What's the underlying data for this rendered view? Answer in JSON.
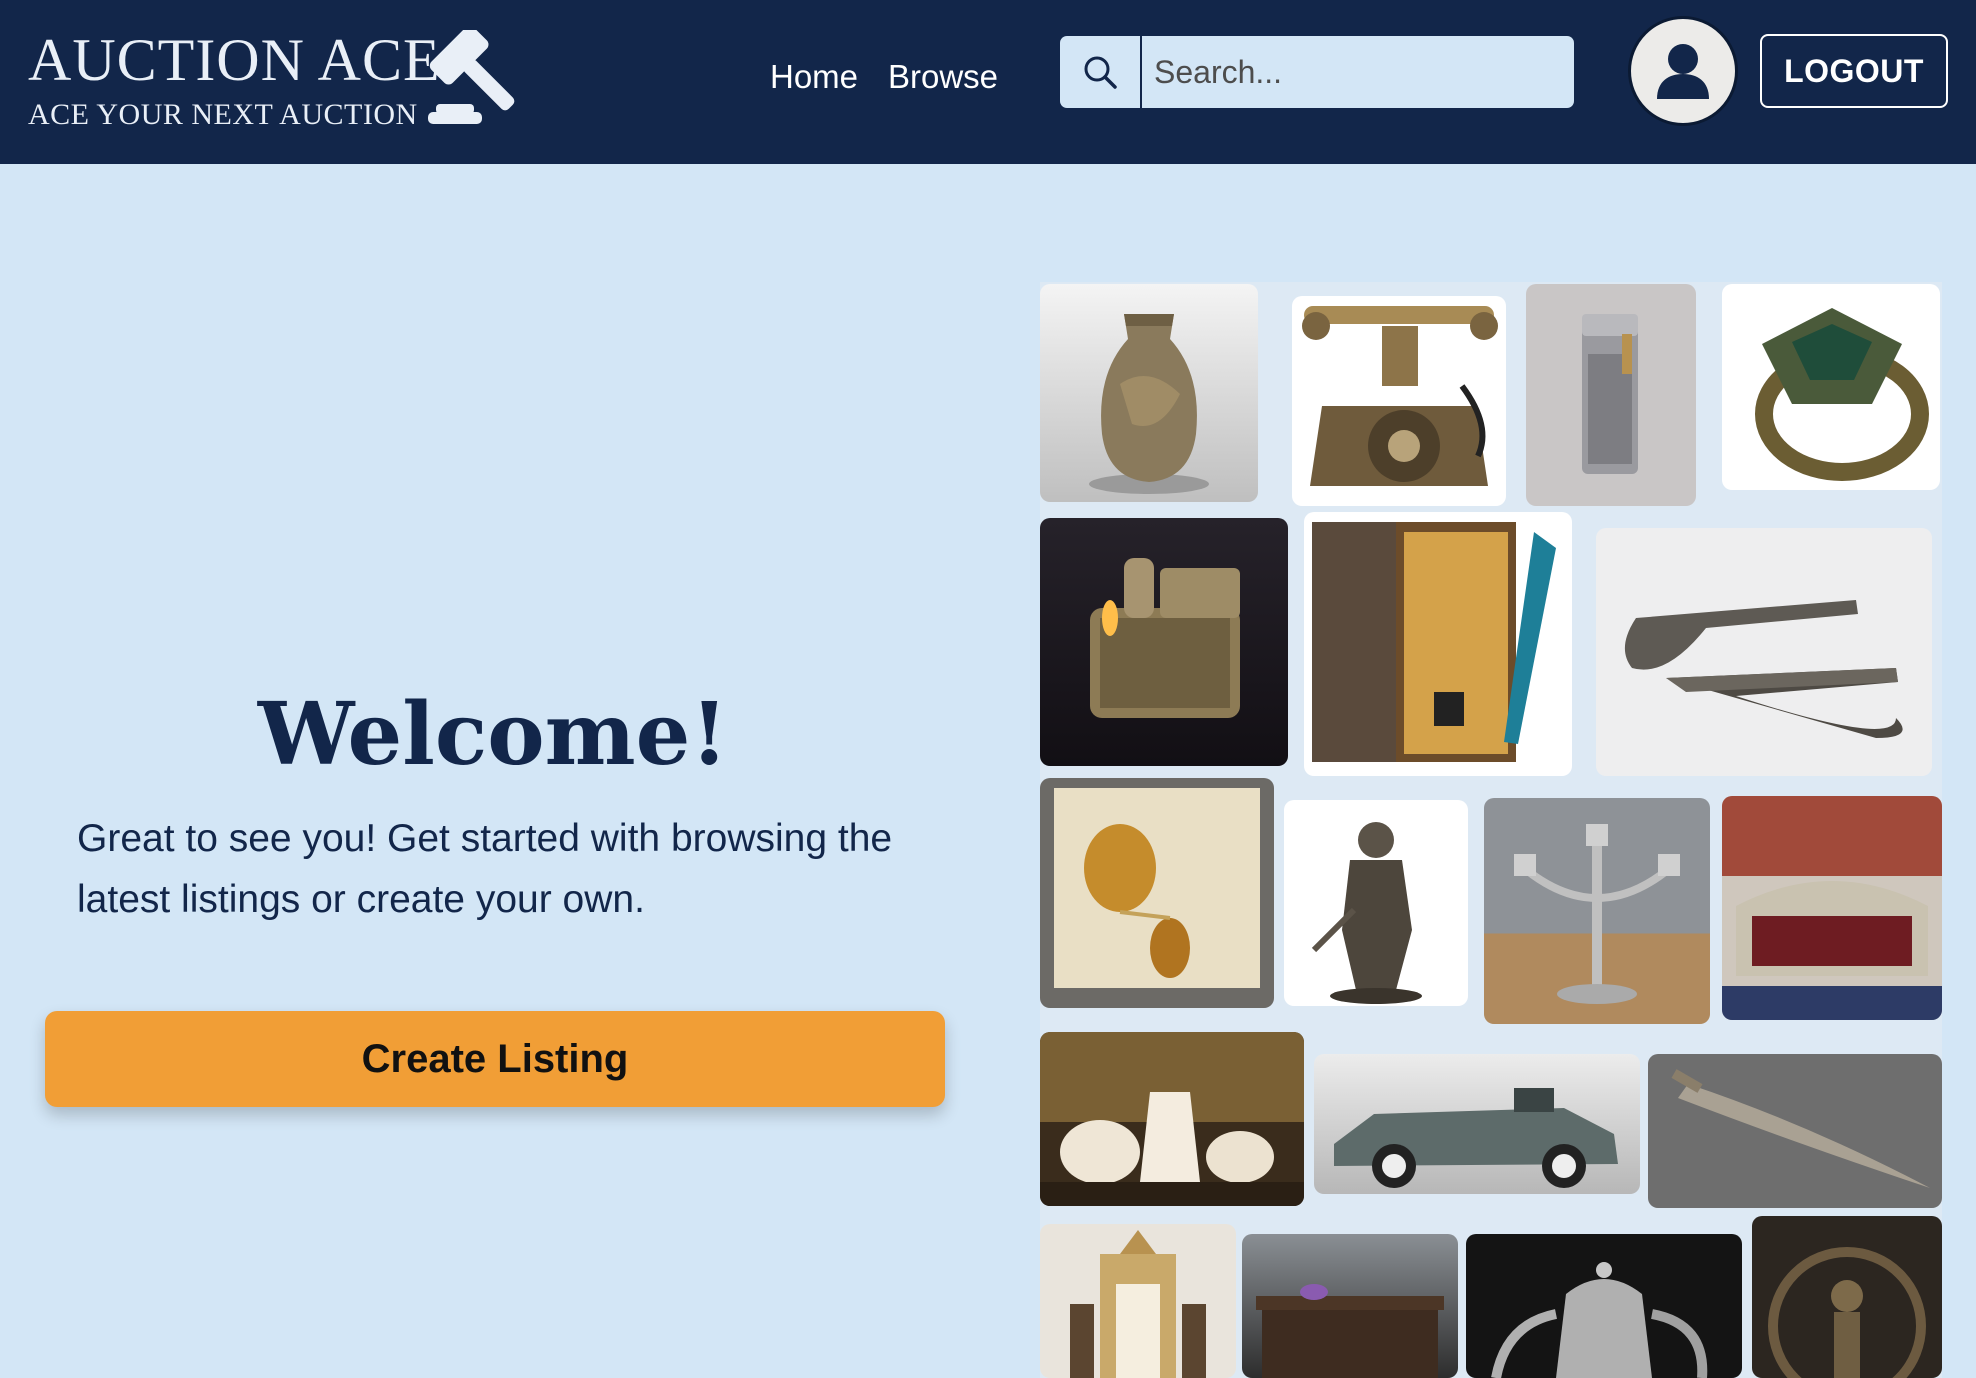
{
  "header": {
    "brand_title": "AUCTION ACE",
    "brand_tagline": "ACE YOUR NEXT AUCTION",
    "nav": [
      {
        "label": "Home"
      },
      {
        "label": "Browse"
      }
    ],
    "search": {
      "placeholder": "Search...",
      "value": ""
    },
    "logout_label": "LOGOUT"
  },
  "main": {
    "welcome_title": "Welcome!",
    "intro_text": "Great to see you! Get started with browsing the latest listings or create your own.",
    "create_listing_label": "Create Listing"
  },
  "gallery": {
    "items": [
      {
        "icon": "bronze-vase"
      },
      {
        "icon": "antique-telephone"
      },
      {
        "icon": "silver-lighter"
      },
      {
        "icon": "jade-ring"
      },
      {
        "icon": "engraved-lighter"
      },
      {
        "icon": "quill-pen-set"
      },
      {
        "icon": "flintlock-pistols"
      },
      {
        "icon": "amber-pendant"
      },
      {
        "icon": "warrior-statue"
      },
      {
        "icon": "candelabra"
      },
      {
        "icon": "baroque-sofa"
      },
      {
        "icon": "porcelain-tea-set"
      },
      {
        "icon": "vintage-car"
      },
      {
        "icon": "sabre"
      },
      {
        "icon": "ornate-clock"
      },
      {
        "icon": "carved-chest"
      },
      {
        "icon": "pewter-teapot"
      },
      {
        "icon": "bronze-deity-statue"
      }
    ]
  },
  "colors": {
    "header_bg": "#12264a",
    "page_bg": "#d3e6f6",
    "accent": "#f19e36",
    "text_dark": "#12264a"
  }
}
